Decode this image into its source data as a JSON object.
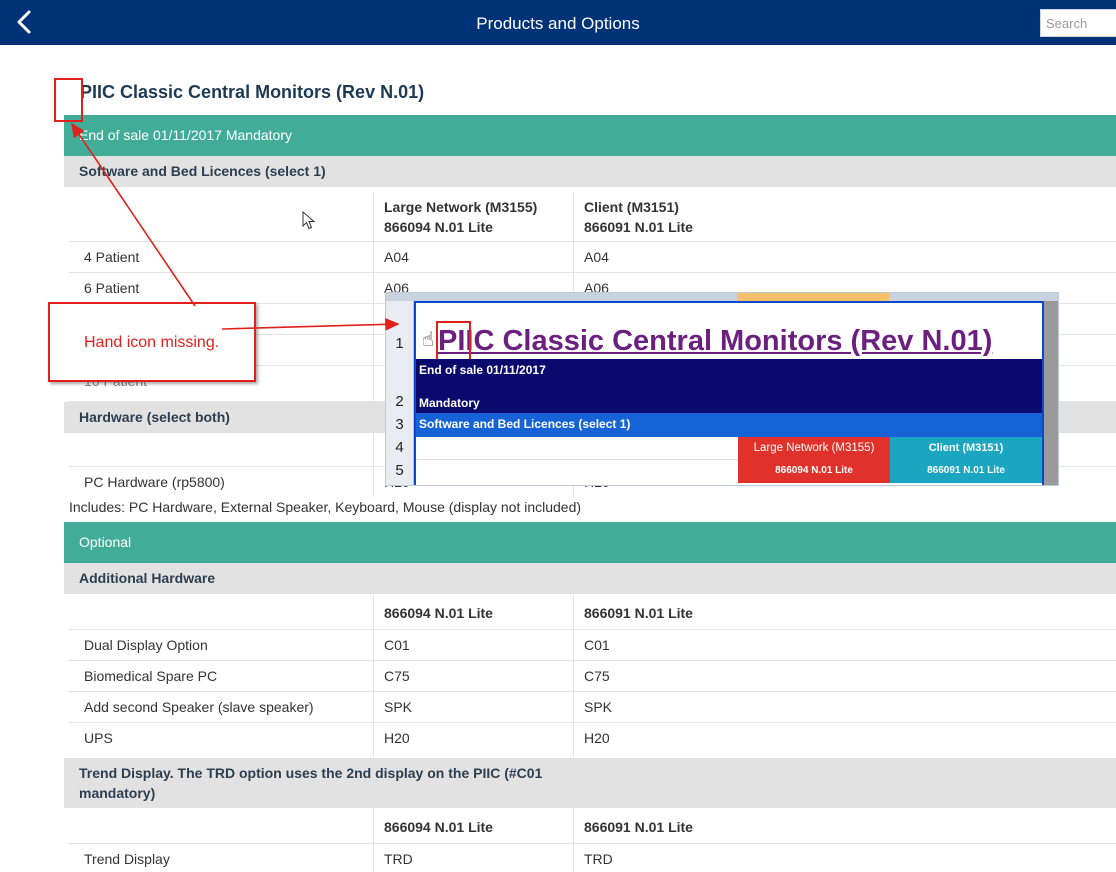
{
  "header": {
    "title": "Products and Options",
    "search_placeholder": "Search",
    "back_icon": "chevron-left-icon"
  },
  "product": {
    "title": "PIIC Classic Central Monitors (Rev N.01)"
  },
  "banner_end_of_sale": "End of sale 01/11/2017 Mandatory",
  "software_section": {
    "title": "Software and Bed Licences (select 1)",
    "col2_line1": "Large Network (M3155)",
    "col2_line2": "866094 N.01 Lite",
    "col3_line1": "Client (M3151)",
    "col3_line2": "866091 N.01 Lite",
    "rows": [
      {
        "label": "4 Patient",
        "v1": "A04",
        "v2": "A04"
      },
      {
        "label": "6 Patient",
        "v1": "A06",
        "v2": "A06"
      },
      {
        "label": "16 Patient",
        "v1": "",
        "v2": ""
      }
    ]
  },
  "hardware_section": {
    "title": "Hardware (select both)",
    "rows": [
      {
        "label": "PC Hardware (rp5800)",
        "v1": "H20",
        "v2": "H20"
      }
    ],
    "includes": "Includes: PC Hardware, External Speaker, Keyboard, Mouse (display not included)"
  },
  "optional_banner": "Optional",
  "additional_section": {
    "title": "Additional Hardware",
    "col2": "866094 N.01 Lite",
    "col3": "866091 N.01 Lite",
    "rows": [
      {
        "label": "Dual Display Option",
        "v1": "C01",
        "v2": "C01"
      },
      {
        "label": "Biomedical Spare PC",
        "v1": "C75",
        "v2": "C75"
      },
      {
        "label": "Add second Speaker (slave speaker)",
        "v1": "SPK",
        "v2": "SPK"
      },
      {
        "label": "UPS",
        "v1": "H20",
        "v2": "H20"
      }
    ]
  },
  "trend_section": {
    "title_line1": "Trend Display. The TRD option uses the 2nd display on the PIIC (#C01",
    "title_line2": "mandatory)",
    "col2": "866094 N.01 Lite",
    "col3": "866091 N.01 Lite",
    "rows": [
      {
        "label": "Trend Display",
        "v1": "TRD",
        "v2": "TRD"
      }
    ]
  },
  "annotation": {
    "callout_text": "Hand icon missing.",
    "color": "#e0201a",
    "inset": {
      "row_numbers": [
        "1",
        "2",
        "3",
        "4",
        "5"
      ],
      "title": "PIIC Classic Central Monitors (Rev N.01)",
      "end_of_sale": "End of sale 01/11/2017",
      "mandatory": "Mandatory",
      "software": "Software and Bed Licences (select 1)",
      "red_line1": "Large Network (M3155)",
      "red_line2": "866094 N.01 Lite",
      "cyan_line1": "Client (M3151)",
      "cyan_line2": "866091 N.01 Lite",
      "hand_icon": "pointing-hand-icon"
    }
  },
  "colors": {
    "header_bg": "#003278",
    "teal_band": "#41ad99",
    "section_bg": "#e2e2e2",
    "title_text": "#1d3a55"
  }
}
